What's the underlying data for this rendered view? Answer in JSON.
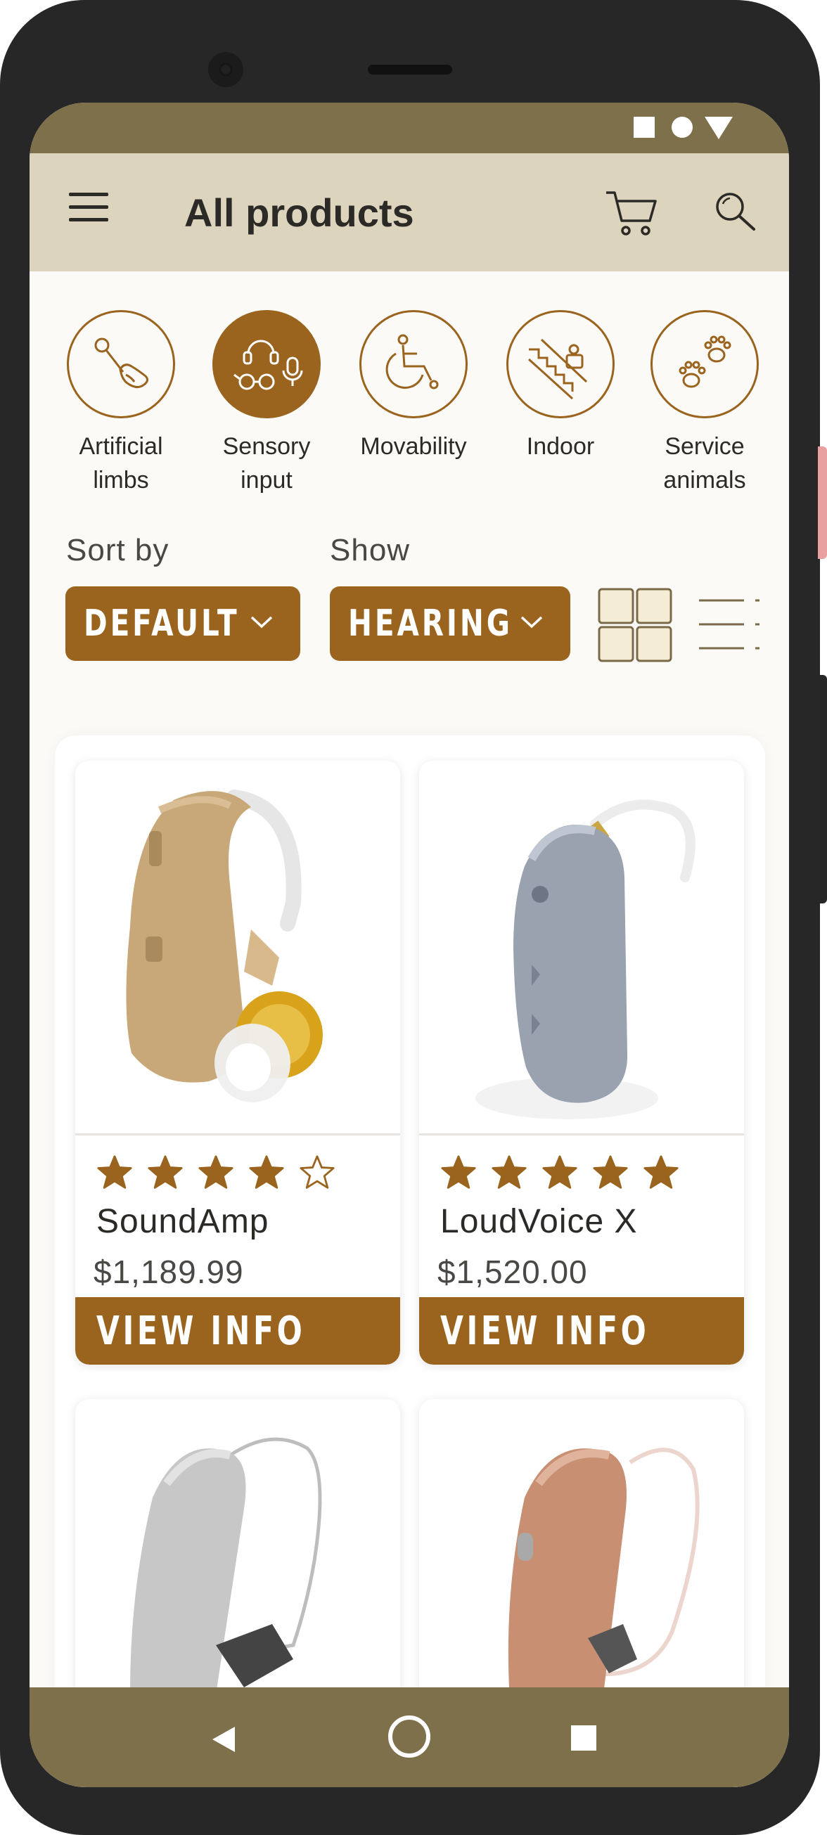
{
  "app": {
    "title": "All products"
  },
  "categories": [
    {
      "label_line1": "Artificial",
      "label_line2": "limbs",
      "icon": "artificial-limb-icon",
      "active": false
    },
    {
      "label_line1": "Sensory",
      "label_line2": "input",
      "icon": "sensory-input-icon",
      "active": true
    },
    {
      "label_line1": "Movability",
      "label_line2": "",
      "icon": "wheelchair-icon",
      "active": false
    },
    {
      "label_line1": "Indoor",
      "label_line2": "",
      "icon": "stairlift-icon",
      "active": false
    },
    {
      "label_line1": "Service",
      "label_line2": "animals",
      "icon": "paw-prints-icon",
      "active": false
    }
  ],
  "filters": {
    "sort_label": "Sort by",
    "sort_value": "DEFAULT",
    "show_label": "Show",
    "show_value": "HEARING",
    "view_mode": "grid"
  },
  "products": [
    {
      "name": "SoundAmp",
      "price": "$1,189.99",
      "rating": 4,
      "max_rating": 5,
      "button": "VIEW INFO"
    },
    {
      "name": "LoudVoice X",
      "price": "$1,520.00",
      "rating": 5,
      "max_rating": 5,
      "button": "VIEW INFO"
    },
    {
      "name": "",
      "price": "",
      "rating": null,
      "max_rating": 5,
      "button": ""
    },
    {
      "name": "",
      "price": "",
      "rating": null,
      "max_rating": 5,
      "button": ""
    }
  ],
  "colors": {
    "accent": "#9a641e",
    "appbar": "#ddd4bd",
    "statusbar": "#7f704c",
    "background": "#fbfaf6",
    "text": "#2b2a26"
  },
  "navigation": {
    "back": "back-icon",
    "home": "home-icon",
    "recents": "recents-icon"
  }
}
